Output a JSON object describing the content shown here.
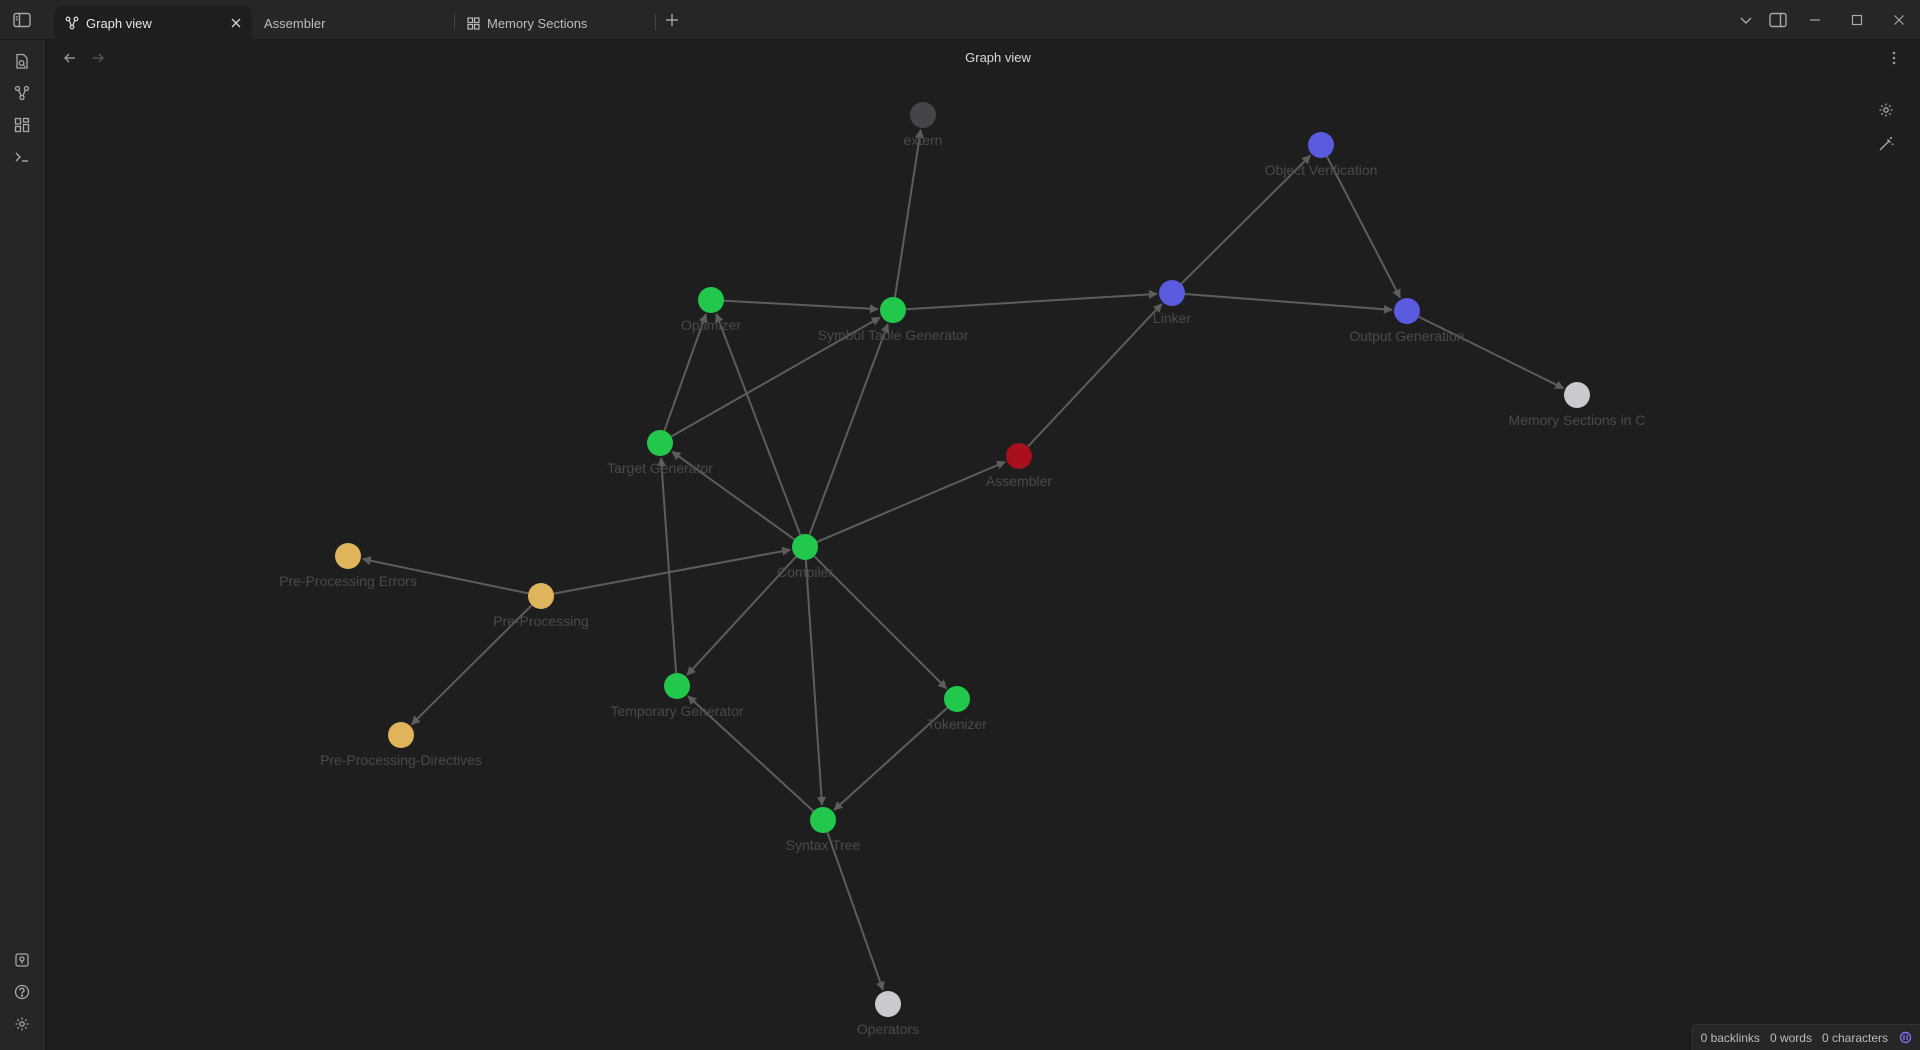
{
  "tabs": [
    {
      "label": "Graph view",
      "icon": "graph-icon",
      "active": true
    },
    {
      "label": "Assembler",
      "icon": "",
      "active": false
    },
    {
      "label": "Memory Sections",
      "icon": "canvas-icon",
      "active": false
    }
  ],
  "view": {
    "title": "Graph view"
  },
  "status": {
    "backlinks": "0 backlinks",
    "words": "0 words",
    "characters": "0 characters"
  },
  "colors": {
    "green": "#22c84b",
    "blue": "#5b5be0",
    "orange": "#e0b45a",
    "red": "#a8101c",
    "grey": "#c9c9cf",
    "dark": "#46444a",
    "edge": "#5d5d5d"
  },
  "graph": {
    "nodes": [
      {
        "id": "extern",
        "label": "extern",
        "color": "dark"
      },
      {
        "id": "object-verification",
        "label": "Object Verification",
        "color": "blue"
      },
      {
        "id": "optimizer",
        "label": "Optimizer",
        "color": "green"
      },
      {
        "id": "symbol-table-generator",
        "label": "Symbol Table Generator",
        "color": "green"
      },
      {
        "id": "linker",
        "label": "Linker",
        "color": "blue"
      },
      {
        "id": "output-generation",
        "label": "Output Generation",
        "color": "blue"
      },
      {
        "id": "memory-sections-in-c",
        "label": "Memory Sections in C",
        "color": "grey"
      },
      {
        "id": "target-generator",
        "label": "Target Generator",
        "color": "green"
      },
      {
        "id": "assembler",
        "label": "Assembler",
        "color": "red"
      },
      {
        "id": "compiler",
        "label": "Compiler",
        "color": "green"
      },
      {
        "id": "pre-processing-errors",
        "label": "Pre-Processing Errors",
        "color": "orange"
      },
      {
        "id": "pre-processing",
        "label": "Pre-Processing",
        "color": "orange"
      },
      {
        "id": "temporary-generator",
        "label": "Temporary Generator",
        "color": "green"
      },
      {
        "id": "tokenizer",
        "label": "Tokenizer",
        "color": "green"
      },
      {
        "id": "pre-processing-directives",
        "label": "Pre-Processing-Directives",
        "color": "orange"
      },
      {
        "id": "syntax-tree",
        "label": "Syntax Tree",
        "color": "green"
      },
      {
        "id": "operators",
        "label": "Operators",
        "color": "grey"
      }
    ],
    "edges": [
      {
        "from": "symbol-table-generator",
        "to": "extern"
      },
      {
        "from": "optimizer",
        "to": "symbol-table-generator"
      },
      {
        "from": "symbol-table-generator",
        "to": "linker"
      },
      {
        "from": "linker",
        "to": "object-verification"
      },
      {
        "from": "linker",
        "to": "output-generation"
      },
      {
        "from": "object-verification",
        "to": "output-generation"
      },
      {
        "from": "output-generation",
        "to": "memory-sections-in-c"
      },
      {
        "from": "target-generator",
        "to": "optimizer"
      },
      {
        "from": "target-generator",
        "to": "symbol-table-generator"
      },
      {
        "from": "compiler",
        "to": "optimizer"
      },
      {
        "from": "compiler",
        "to": "symbol-table-generator"
      },
      {
        "from": "compiler",
        "to": "target-generator"
      },
      {
        "from": "compiler",
        "to": "assembler"
      },
      {
        "from": "assembler",
        "to": "linker"
      },
      {
        "from": "pre-processing",
        "to": "compiler"
      },
      {
        "from": "pre-processing",
        "to": "pre-processing-errors"
      },
      {
        "from": "pre-processing",
        "to": "pre-processing-directives"
      },
      {
        "from": "compiler",
        "to": "temporary-generator"
      },
      {
        "from": "temporary-generator",
        "to": "target-generator"
      },
      {
        "from": "compiler",
        "to": "tokenizer"
      },
      {
        "from": "compiler",
        "to": "syntax-tree"
      },
      {
        "from": "tokenizer",
        "to": "syntax-tree"
      },
      {
        "from": "syntax-tree",
        "to": "temporary-generator"
      },
      {
        "from": "syntax-tree",
        "to": "operators"
      }
    ]
  }
}
